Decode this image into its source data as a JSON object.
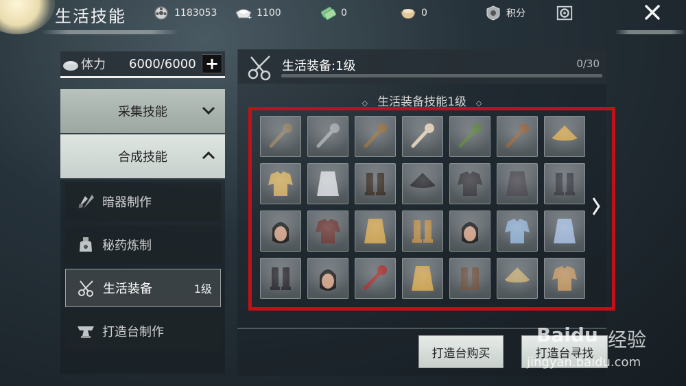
{
  "header": {
    "title": "生活技能",
    "resources": [
      {
        "icon": "coin-reel-icon",
        "value": "1183053"
      },
      {
        "icon": "silver-ingot-icon",
        "value": "1100"
      },
      {
        "icon": "jade-ticket-icon",
        "value": "0"
      },
      {
        "icon": "bowl-icon",
        "value": "0"
      }
    ],
    "points_label": "积分",
    "close_icon": "close-icon"
  },
  "left": {
    "stamina_label": "体力",
    "stamina_value": "6000/6000",
    "plus_label": "+",
    "categories": [
      {
        "label": "采集技能",
        "expanded": false
      },
      {
        "label": "合成技能",
        "expanded": true
      }
    ],
    "subitems": [
      {
        "label": "暗器制作",
        "icon": "hidden-weapon-icon",
        "level": ""
      },
      {
        "label": "秘药炼制",
        "icon": "potion-jar-icon",
        "level": ""
      },
      {
        "label": "生活装备",
        "icon": "scissors-icon",
        "level": "1级",
        "active": true
      },
      {
        "label": "打造台制作",
        "icon": "anvil-icon",
        "level": ""
      }
    ]
  },
  "right": {
    "title": "生活装备:1级",
    "progress": "0/30",
    "progress_fraction": 0,
    "section_title": "生活装备技能1级",
    "section_deco": "◇",
    "items": [
      [
        "hook-tool",
        "axe",
        "shovel",
        "fan",
        "ribbon-bow",
        "bow",
        "straw-hat"
      ],
      [
        "gold-robe",
        "silver-cape",
        "boots-wooden",
        "bamboo-hat-mask",
        "dark-armor",
        "dark-skirt",
        "dark-greaves"
      ],
      [
        "hair-bun-face",
        "fur-collar",
        "gold-skirt",
        "gold-greaves",
        "topknot-face",
        "blue-robe",
        "blue-cape"
      ],
      [
        "black-boots",
        "long-hair-face",
        "red-gift-box",
        "gold-pants",
        "brown-boots",
        "gold-hat-mask",
        "gold-shoulder-robe"
      ]
    ],
    "buttons": {
      "buy": "打造台购买",
      "find": "打造台寻找"
    }
  },
  "watermark": {
    "brand": "Baidu",
    "cn": "经验",
    "url": "jingyan.baidu.com"
  },
  "colors": {
    "highlight_frame": "#c2101a"
  }
}
